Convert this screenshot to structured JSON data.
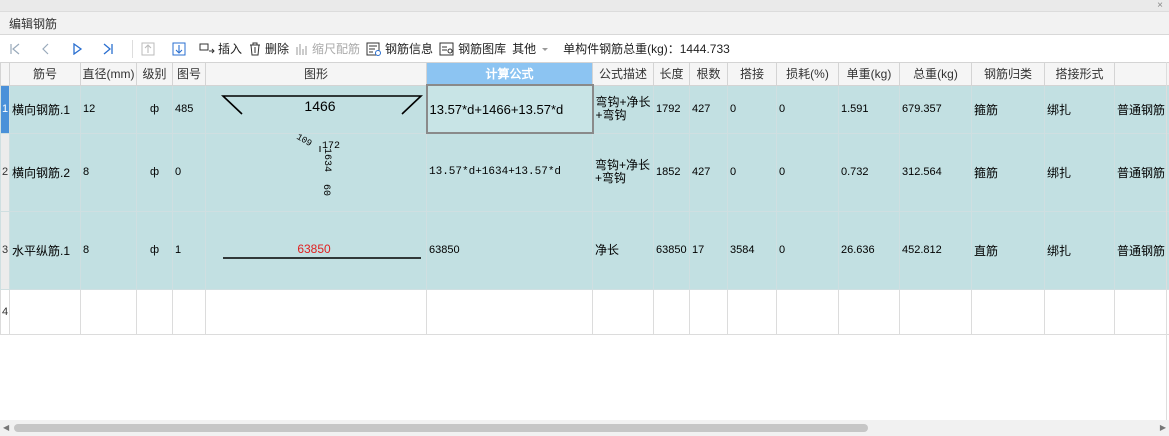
{
  "window": {
    "title": "编辑钢筋",
    "close_glyph": "×"
  },
  "toolbar": {
    "insert": "插入",
    "delete": "删除",
    "scale": "缩尺配筋",
    "info": "钢筋信息",
    "library": "钢筋图库",
    "other": "其他",
    "total_weight_label": "单构件钢筋总重(kg)：1444.733"
  },
  "columns": [
    "筋号",
    "直径(mm)",
    "级别",
    "图号",
    "图形",
    "计算公式",
    "公式描述",
    "长度",
    "根数",
    "搭接",
    "损耗(%)",
    "单重(kg)",
    "总重(kg)",
    "钢筋归类",
    "搭接形式",
    ""
  ],
  "rows": [
    {
      "num": "1",
      "name": "横向钢筋.1",
      "dia": "12",
      "grade": "ф",
      "fig": "485",
      "shape_label": "1466",
      "formula": "13.57*d+1466+13.57*d",
      "desc": "弯钩+净长+弯钩",
      "length": "1792",
      "count": "427",
      "lap": "0",
      "loss": "0",
      "unit_w": "1.591",
      "total_w": "679.357",
      "category": "箍筋",
      "lap_type": "绑扎",
      "type": "普通钢筋"
    },
    {
      "num": "2",
      "name": "横向钢筋.2",
      "dia": "8",
      "grade": "ф",
      "fig": "0",
      "shape_a": "109",
      "shape_b": "172",
      "shape_c": "1634",
      "shape_d": "60",
      "formula": "13.57*d+1634+13.57*d",
      "desc": "弯钩+净长+弯钩",
      "length": "1852",
      "count": "427",
      "lap": "0",
      "loss": "0",
      "unit_w": "0.732",
      "total_w": "312.564",
      "category": "箍筋",
      "lap_type": "绑扎",
      "type": "普通钢筋"
    },
    {
      "num": "3",
      "name": "水平纵筋.1",
      "dia": "8",
      "grade": "ф",
      "fig": "1",
      "shape_label": "63850",
      "formula": "63850",
      "desc": "净长",
      "length": "63850",
      "count": "17",
      "lap": "3584",
      "loss": "0",
      "unit_w": "26.636",
      "total_w": "452.812",
      "category": "直筋",
      "lap_type": "绑扎",
      "type": "普通钢筋"
    }
  ],
  "empty_row_num": "4",
  "colors": {
    "row_bg": "#c2e0e2",
    "selected_header": "#8cc4f2",
    "red_label": "#e02020"
  }
}
